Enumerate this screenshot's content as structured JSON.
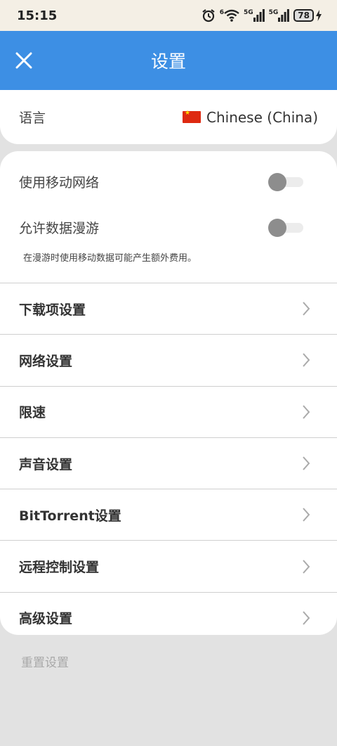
{
  "status_bar": {
    "time": "15:15",
    "signal1_label": "5G",
    "signal2_label": "5G",
    "wifi_badge": "6",
    "battery": "78"
  },
  "app_bar": {
    "title": "设置",
    "close_icon": "close-icon",
    "color": "#3d8fe4"
  },
  "language": {
    "label": "语言",
    "value": "Chinese (China)",
    "flag_icon": "china-flag-icon"
  },
  "toggles": [
    {
      "label": "使用移动网络",
      "on": false
    },
    {
      "label": "允许数据漫游",
      "on": false
    }
  ],
  "roaming_note": "在漫游时使用移动数据可能产生额外费用。",
  "menu": [
    {
      "label": "下载项设置"
    },
    {
      "label": "网络设置"
    },
    {
      "label": "限速"
    },
    {
      "label": "声音设置"
    },
    {
      "label": "BitTorrent设置"
    },
    {
      "label": "远程控制设置"
    },
    {
      "label": "高级设置"
    }
  ],
  "reset_label": "重置设置"
}
